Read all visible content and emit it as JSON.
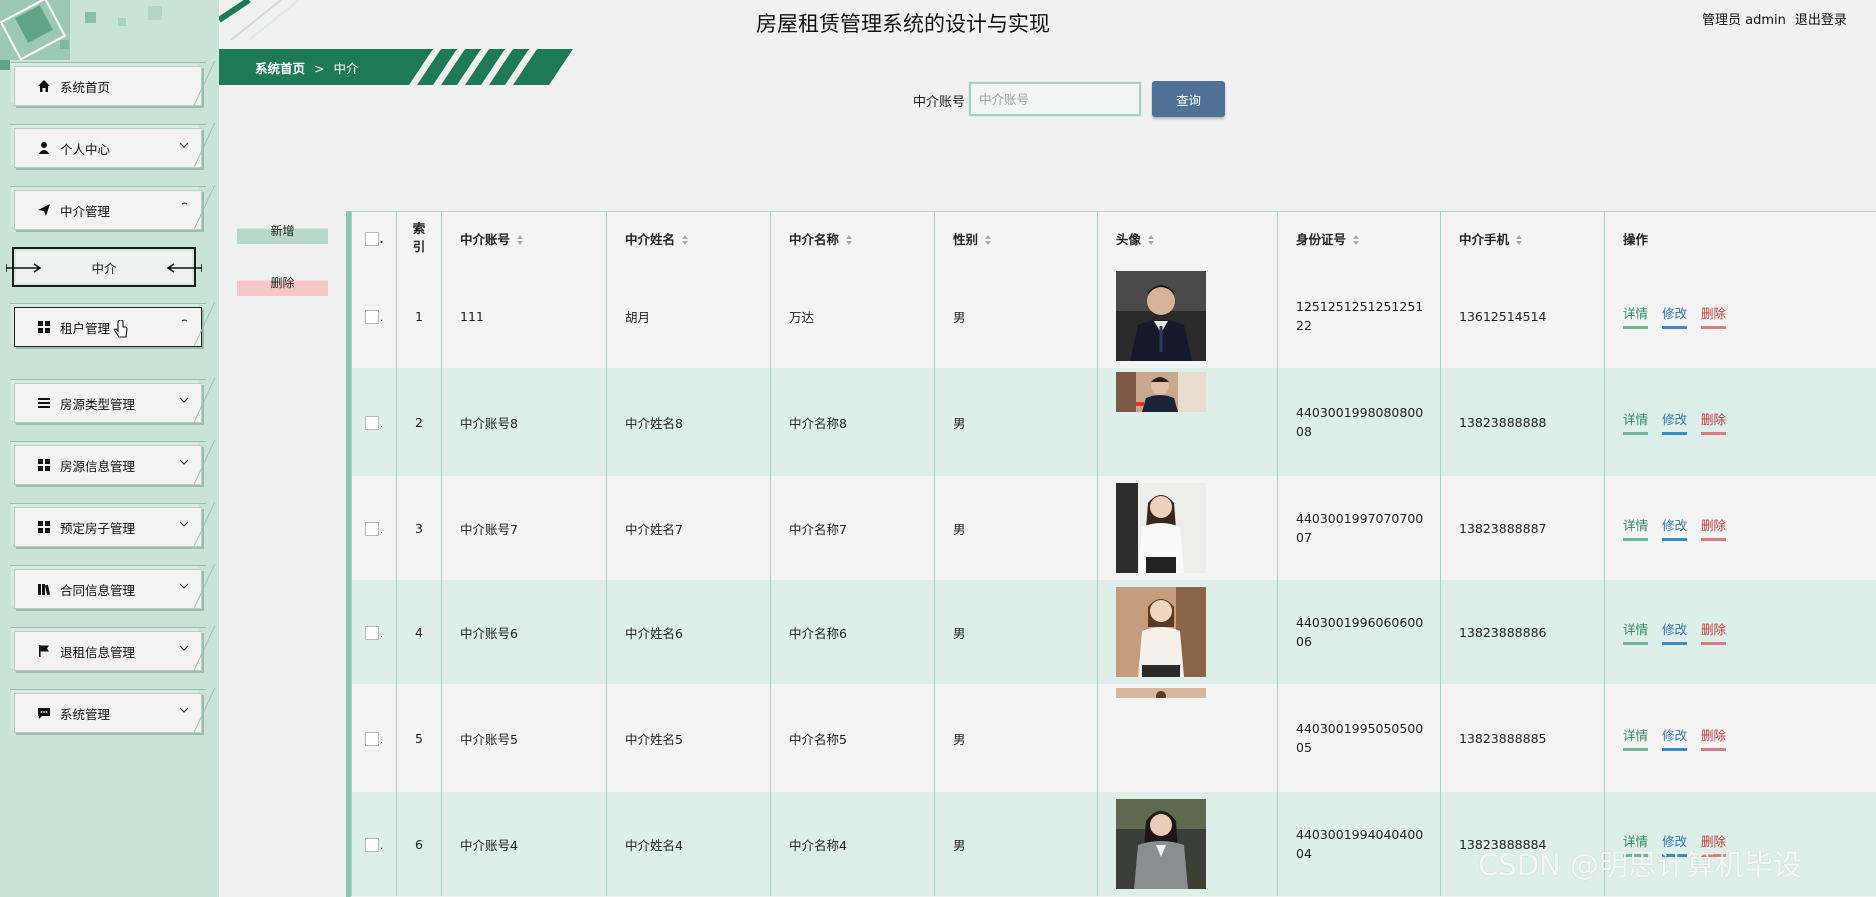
{
  "header": {
    "title": "房屋租赁管理系统的设计与实现",
    "user_label": "管理员 admin",
    "logout": "退出登录"
  },
  "breadcrumb": {
    "home": "系统首页",
    "separator": ">",
    "current": "中介"
  },
  "sidebar": {
    "items": [
      {
        "label": "系统首页",
        "icon": "home-icon"
      },
      {
        "label": "个人中心",
        "icon": "user-icon"
      },
      {
        "label": "中介管理",
        "icon": "send-icon"
      },
      {
        "label": "租户管理",
        "icon": "grid-icon"
      },
      {
        "label": "房源类型管理",
        "icon": "list-icon"
      },
      {
        "label": "房源信息管理",
        "icon": "grid-icon"
      },
      {
        "label": "预定房子管理",
        "icon": "grid-icon"
      },
      {
        "label": "合同信息管理",
        "icon": "library-icon"
      },
      {
        "label": "退租信息管理",
        "icon": "flag-icon"
      },
      {
        "label": "系统管理",
        "icon": "chat-icon"
      }
    ],
    "submenu": {
      "label": "中介"
    }
  },
  "search": {
    "label": "中介账号",
    "placeholder": "中介账号",
    "button": "查询"
  },
  "actions": {
    "add": "新增",
    "delete": "删除"
  },
  "table": {
    "columns": [
      "索引",
      "中介账号",
      "中介姓名",
      "中介名称",
      "性别",
      "头像",
      "身份证号",
      "中介手机",
      "操作"
    ],
    "rows": [
      {
        "index": "1",
        "account": "111",
        "name": "胡月",
        "company": "万达",
        "gender": "男",
        "idcard": "125125125125125122",
        "phone": "13612514514"
      },
      {
        "index": "2",
        "account": "中介账号8",
        "name": "中介姓名8",
        "company": "中介名称8",
        "gender": "男",
        "idcard": "440300199808080008",
        "phone": "13823888888"
      },
      {
        "index": "3",
        "account": "中介账号7",
        "name": "中介姓名7",
        "company": "中介名称7",
        "gender": "男",
        "idcard": "440300199707070007",
        "phone": "13823888887"
      },
      {
        "index": "4",
        "account": "中介账号6",
        "name": "中介姓名6",
        "company": "中介名称6",
        "gender": "男",
        "idcard": "440300199606060006",
        "phone": "13823888886"
      },
      {
        "index": "5",
        "account": "中介账号5",
        "name": "中介姓名5",
        "company": "中介名称5",
        "gender": "男",
        "idcard": "440300199505050005",
        "phone": "13823888885"
      },
      {
        "index": "6",
        "account": "中介账号4",
        "name": "中介姓名4",
        "company": "中介名称4",
        "gender": "男",
        "idcard": "440300199404040004",
        "phone": "13823888884"
      }
    ],
    "ops": {
      "detail": "详情",
      "edit": "修改",
      "delete": "删除"
    }
  },
  "watermark": "CSDN @明思计算机毕设",
  "colors": {
    "sidebar_bg": "#c9e3d6",
    "accent": "#1e7a55",
    "search_button": "#4f7196"
  }
}
